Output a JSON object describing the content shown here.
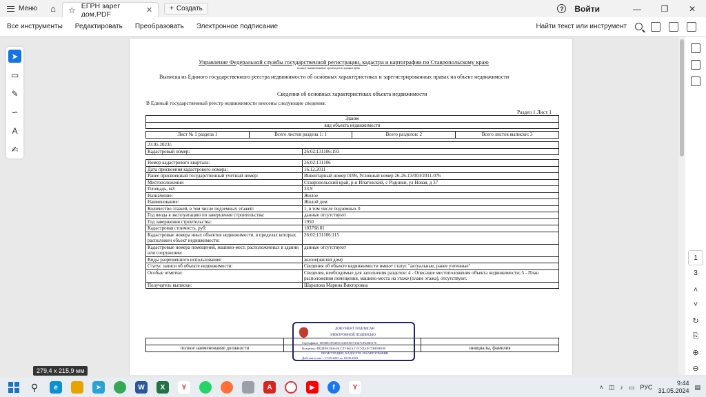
{
  "titlebar": {
    "menu_label": "Меню",
    "tab_title": "ЕГРН зарег дом.PDF",
    "new_tab_label": "Создать",
    "signin_label": "Войти"
  },
  "toolbar": {
    "items": [
      "Все инструменты",
      "Редактировать",
      "Преобразовать",
      "Электронное подписание"
    ],
    "search_label": "Найти текст или инструмент"
  },
  "document": {
    "header_org": "Управление Федеральной службы государственной регистрации, кадастра и картографии по Ставропольскому краю",
    "header_org_sub": "полное наименование органа регистрации прав",
    "title": "Выписка из Единого государственного реестра недвижимости об основных характеристиках и зарегистрированных правах на объект недвижимости",
    "section_title": "Сведения об основных характеристиках объекта недвижимости",
    "intro": "В Единый государственный реестр недвижимости внесены следующие сведения:",
    "section_ref": "Раздел 1 Лист 1",
    "object_type": "Здание",
    "object_type_sub": "вид объекта недвижимости",
    "sheets": [
      "Лист № 1 раздела 1",
      "Всего листов раздела 1: 1",
      "Всего разделов: 2",
      "Всего листов выписки: 3"
    ],
    "date": "23.05.2023г.",
    "cadastral_label": "Кадастровый номер:",
    "cadastral_value": "26:02:131106:193",
    "rows": [
      {
        "label": "Номер кадастрового квартала:",
        "value": "26:02:131106"
      },
      {
        "label": "Дата присвоения кадастрового номера:",
        "value": "16.12.2011"
      },
      {
        "label": "Ранее присвоенный государственный учетный номер:",
        "value": "Инвентарный номер 0199, Условный номер 26-26-13/003/2011-076"
      },
      {
        "label": "Местоположение:",
        "value": "Ставропольский край, р-н Ипатовский, с Родники, ул Новая, д 37"
      },
      {
        "label": "Площадь, м2:",
        "value": "33.9"
      },
      {
        "label": "Назначение:",
        "value": "Жилое"
      },
      {
        "label": "Наименование:",
        "value": "Жилой дом"
      },
      {
        "label": "Количество этажей, в том числе подземных этажей:",
        "value": "1, в том числе подземных 0"
      },
      {
        "label": "Год ввода в эксплуатацию по завершении строительства:",
        "value": "данные отсутствуют"
      },
      {
        "label": "Год завершения строительства:",
        "value": "1950"
      },
      {
        "label": "Кадастровая стоимость, руб:",
        "value": "103768.81"
      },
      {
        "label": "Кадастровые номера иных объектов недвижимости, в пределах которых расположен объект недвижимости:",
        "value": "26:02:131106:115"
      },
      {
        "label": "Кадастровые номера помещений, машино-мест, расположенных в здании или сооружении:",
        "value": "данные отсутствуют"
      },
      {
        "label": "Виды разрешенного использования:",
        "value": "жилое(жилой дом)"
      },
      {
        "label": "Статус записи об объекте недвижимости:",
        "value": "Сведения об объекте недвижимости имеют статус \"актуальные, ранее учтенные\""
      },
      {
        "label": "Особые отметки:",
        "value": "Сведения, необходимые для заполнения разделов: 4 - Описание местоположения объекта недвижимости; 5 - План расположения помещения, машино-места на этаже (плане этажа), отсутствуют."
      },
      {
        "label": "Получатель выписки:",
        "value": "Шарапова Марина Викторовна"
      }
    ],
    "footer_left": "полное наименование должности",
    "footer_right": "инициалы, фамилия",
    "stamp": {
      "line1": "ДОКУМЕНТ ПОДПИСАН",
      "line2": "ЭЛЕКТРОННОЙ ПОДПИСЬЮ",
      "cert": "Сертификат: 00948C9FAB5CA3EE5E7A347CF426FA78",
      "owner": "Владелец: ФЕДЕРАЛЬНАЯ СЛУЖБА ГОСУДАРСТВЕННОЙ",
      "owner2": "РЕГИСТРАЦИИ, КАДАСТРА И КАРТОГРАФИИ",
      "valid": "Действителен: с 17.05.2022 по 10.08.2023"
    }
  },
  "viewer": {
    "dimensions": "279,4 x 215,9 мм",
    "page_current": "1",
    "page_total": "3"
  },
  "taskbar": {
    "lang": "РУС",
    "time": "9:44",
    "date": "31.05.2024"
  }
}
